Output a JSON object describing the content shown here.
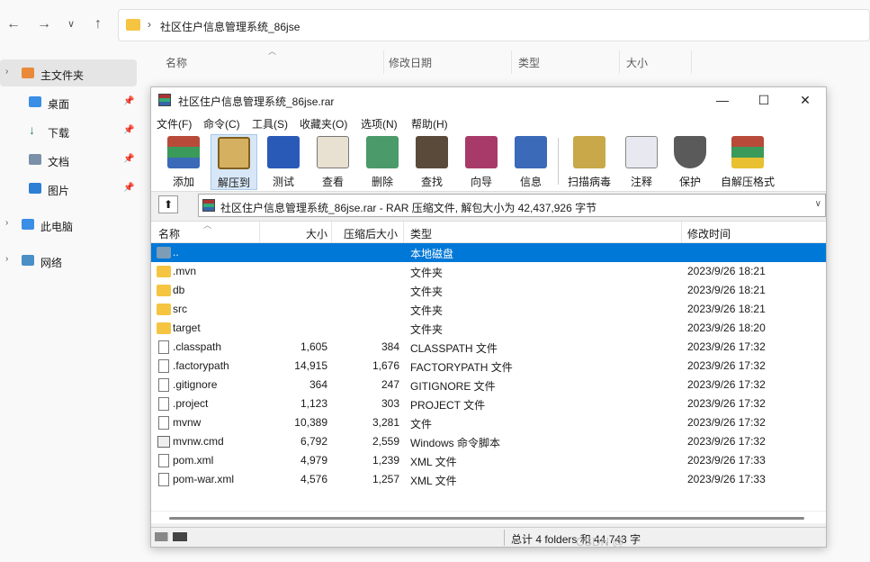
{
  "explorer": {
    "address": "社区住户信息管理系统_86jse",
    "columns": [
      "名称",
      "修改日期",
      "类型",
      "大小"
    ],
    "sidebar": [
      {
        "label": "主文件夹",
        "pinned": false
      },
      {
        "label": "桌面",
        "pinned": true
      },
      {
        "label": "下载",
        "pinned": true
      },
      {
        "label": "文档",
        "pinned": true
      },
      {
        "label": "图片",
        "pinned": true
      },
      {
        "label": "此电脑",
        "pinned": false
      },
      {
        "label": "网络",
        "pinned": false
      }
    ]
  },
  "rar": {
    "title": "社区住户信息管理系统_86jse.rar",
    "menu": [
      "文件(F)",
      "命令(C)",
      "工具(S)",
      "收藏夹(O)",
      "选项(N)",
      "帮助(H)"
    ],
    "toolbar": [
      "添加",
      "解压到",
      "测试",
      "查看",
      "删除",
      "查找",
      "向导",
      "信息",
      "扫描病毒",
      "注释",
      "保护",
      "自解压格式"
    ],
    "path": "社区住户信息管理系统_86jse.rar - RAR 压缩文件, 解包大小为 42,437,926 字节",
    "columns": [
      "名称",
      "大小",
      "压缩后大小",
      "类型",
      "修改时间"
    ],
    "rows": [
      {
        "name": "..",
        "size": "",
        "packed": "",
        "type": "本地磁盘",
        "modified": "",
        "kind": "up",
        "selected": true
      },
      {
        "name": ".mvn",
        "size": "",
        "packed": "",
        "type": "文件夹",
        "modified": "2023/9/26 18:21",
        "kind": "folder"
      },
      {
        "name": "db",
        "size": "",
        "packed": "",
        "type": "文件夹",
        "modified": "2023/9/26 18:21",
        "kind": "folder"
      },
      {
        "name": "src",
        "size": "",
        "packed": "",
        "type": "文件夹",
        "modified": "2023/9/26 18:21",
        "kind": "folder"
      },
      {
        "name": "target",
        "size": "",
        "packed": "",
        "type": "文件夹",
        "modified": "2023/9/26 18:20",
        "kind": "folder"
      },
      {
        "name": ".classpath",
        "size": "1,605",
        "packed": "384",
        "type": "CLASSPATH 文件",
        "modified": "2023/9/26 17:32",
        "kind": "file"
      },
      {
        "name": ".factorypath",
        "size": "14,915",
        "packed": "1,676",
        "type": "FACTORYPATH 文件",
        "modified": "2023/9/26 17:32",
        "kind": "file"
      },
      {
        "name": ".gitignore",
        "size": "364",
        "packed": "247",
        "type": "GITIGNORE 文件",
        "modified": "2023/9/26 17:32",
        "kind": "file"
      },
      {
        "name": ".project",
        "size": "1,123",
        "packed": "303",
        "type": "PROJECT 文件",
        "modified": "2023/9/26 17:32",
        "kind": "file"
      },
      {
        "name": "mvnw",
        "size": "10,389",
        "packed": "3,281",
        "type": "文件",
        "modified": "2023/9/26 17:32",
        "kind": "file"
      },
      {
        "name": "mvnw.cmd",
        "size": "6,792",
        "packed": "2,559",
        "type": "Windows 命令脚本",
        "modified": "2023/9/26 17:32",
        "kind": "cmd"
      },
      {
        "name": "pom.xml",
        "size": "4,979",
        "packed": "1,239",
        "type": "XML 文件",
        "modified": "2023/9/26 17:33",
        "kind": "file"
      },
      {
        "name": "pom-war.xml",
        "size": "4,576",
        "packed": "1,257",
        "type": "XML 文件",
        "modified": "2023/9/26 17:33",
        "kind": "file"
      }
    ],
    "status": "总计 4 folders 和 44,743 字"
  },
  "watermark": "CSDN @"
}
